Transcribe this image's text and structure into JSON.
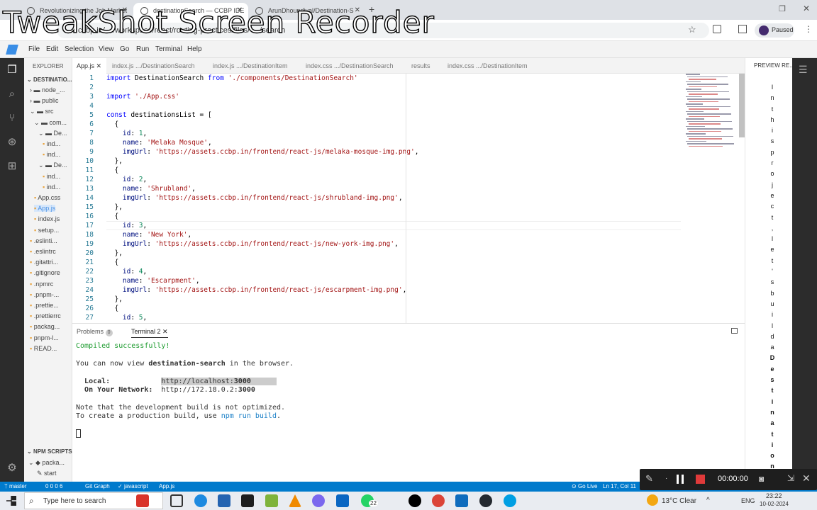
{
  "browser": {
    "tabs": [
      {
        "label": "Revolutionizing the Job Market",
        "active": false
      },
      {
        "label": "destinationSearch — CCBP IDE",
        "active": true
      },
      {
        "label": "ArunDhoundiyal/Destination-S",
        "active": false
      }
    ],
    "url": "ccbp.in/…/workspace/react/routing-practices/files/ …/search",
    "paused_label": "Paused",
    "watermark": "TweakShot Screen Recorder"
  },
  "menu": [
    "File",
    "Edit",
    "Selection",
    "View",
    "Go",
    "Run",
    "Terminal",
    "Help"
  ],
  "explorer": {
    "header": "EXPLORER",
    "root": "DESTINATIO...",
    "items": [
      {
        "label": "node_...",
        "indent": 1,
        "kind": "folder"
      },
      {
        "label": "public",
        "indent": 1,
        "kind": "folder"
      },
      {
        "label": "src",
        "indent": 1,
        "kind": "folder-open"
      },
      {
        "label": "com...",
        "indent": 2,
        "kind": "folder-open"
      },
      {
        "label": "De...",
        "indent": 3,
        "kind": "folder-open"
      },
      {
        "label": "ind...",
        "indent": 4,
        "kind": "file"
      },
      {
        "label": "ind...",
        "indent": 4,
        "kind": "file"
      },
      {
        "label": "De...",
        "indent": 3,
        "kind": "folder-open"
      },
      {
        "label": "ind...",
        "indent": 4,
        "kind": "file"
      },
      {
        "label": "ind...",
        "indent": 4,
        "kind": "file"
      },
      {
        "label": "App.css",
        "indent": 2,
        "kind": "file"
      },
      {
        "label": "App.js",
        "indent": 2,
        "kind": "file"
      },
      {
        "label": "index.js",
        "indent": 2,
        "kind": "file"
      },
      {
        "label": "setup...",
        "indent": 2,
        "kind": "file"
      },
      {
        "label": ".eslinti...",
        "indent": 1,
        "kind": "file"
      },
      {
        "label": ".eslintrc",
        "indent": 1,
        "kind": "file"
      },
      {
        "label": ".gitattri...",
        "indent": 1,
        "kind": "file"
      },
      {
        "label": ".gitignore",
        "indent": 1,
        "kind": "file"
      },
      {
        "label": ".npmrc",
        "indent": 1,
        "kind": "file"
      },
      {
        "label": ".pnpm-...",
        "indent": 1,
        "kind": "file"
      },
      {
        "label": ".prettie...",
        "indent": 1,
        "kind": "file"
      },
      {
        "label": ".prettierrc",
        "indent": 1,
        "kind": "file"
      },
      {
        "label": "packag...",
        "indent": 1,
        "kind": "file"
      },
      {
        "label": "pnpm-l...",
        "indent": 1,
        "kind": "file"
      },
      {
        "label": "READ...",
        "indent": 1,
        "kind": "file"
      }
    ],
    "npm_header": "NPM SCRIPTS",
    "npm_items": [
      "packa...",
      "start"
    ]
  },
  "editor_tabs": [
    {
      "label": "App.js",
      "active": true
    },
    {
      "label": "index.js .../DestinationSearch",
      "active": false
    },
    {
      "label": "index.js .../DestinationItem",
      "active": false
    },
    {
      "label": "index.css .../DestinationSearch",
      "active": false
    },
    {
      "label": "results",
      "active": false
    },
    {
      "label": "index.css .../DestinationItem",
      "active": false
    }
  ],
  "preview_header": "PREVIEW RE...",
  "preview_text": "In this project, let's build a Destination",
  "code_lines": [
    "import DestinationSearch from './components/DestinationSearch'",
    "",
    "import './App.css'",
    "",
    "const destinationsList = [",
    "  {",
    "    id: 1,",
    "    name: 'Melaka Mosque',",
    "    imgUrl: 'https://assets.ccbp.in/frontend/react-js/melaka-mosque-img.png',",
    "  },",
    "  {",
    "    id: 2,",
    "    name: 'Shrubland',",
    "    imgUrl: 'https://assets.ccbp.in/frontend/react-js/shrubland-img.png',",
    "  },",
    "  {",
    "    id: 3,",
    "    name: 'New York',",
    "    imgUrl: 'https://assets.ccbp.in/frontend/react-js/new-york-img.png',",
    "  },",
    "  {",
    "    id: 4,",
    "    name: 'Escarpment',",
    "    imgUrl: 'https://assets.ccbp.in/frontend/react-js/escarpment-img.png',",
    "  },",
    "  {",
    "    id: 5,"
  ],
  "panel": {
    "tabs": [
      "Problems",
      "Terminal 2"
    ],
    "lines": [
      "Compiled successfully!",
      "",
      "You can now view destination-search in the browser.",
      "",
      "  Local:            http://localhost:3000",
      "  On Your Network:  http://172.18.0.2:3000",
      "",
      "Note that the development build is not optimized.",
      "To create a production build, use npm run build."
    ]
  },
  "status": {
    "branch": "master",
    "problems": "0 0 0 6",
    "git_graph": "Git Graph",
    "language": "javascript",
    "file": "App.js",
    "go_live": "Go Live",
    "position": "Ln 17, Col 11"
  },
  "recorder": {
    "timer": "00:00:00"
  },
  "taskbar": {
    "search_placeholder": "Type here to search",
    "weather": "13°C  Clear",
    "lang": "ENG",
    "time": "23:22",
    "date": "10-02-2024",
    "badge": "22"
  }
}
